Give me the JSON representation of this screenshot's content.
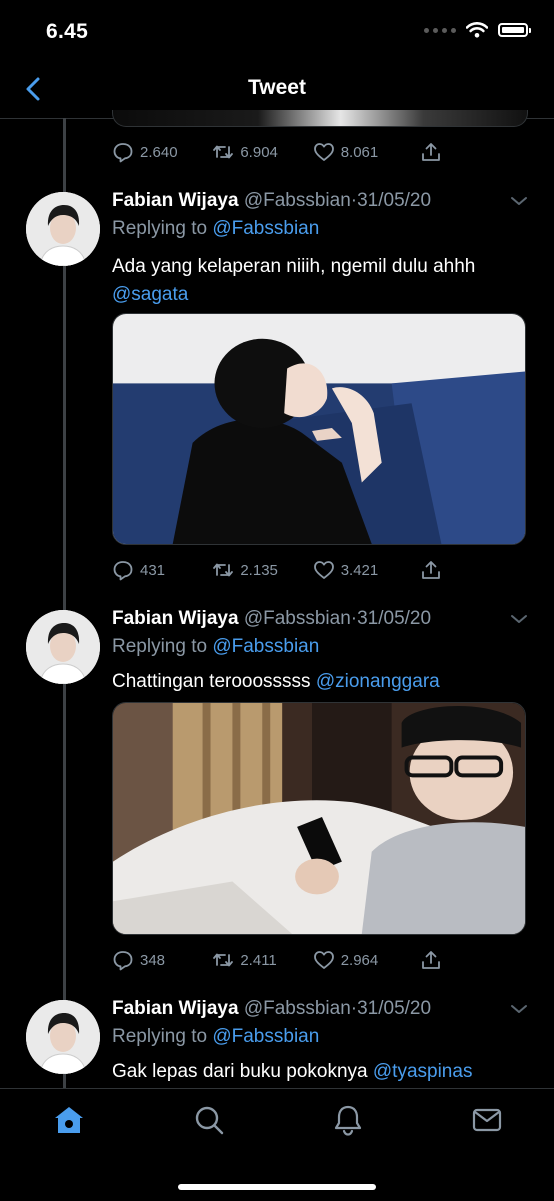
{
  "status_bar": {
    "time": "6.45"
  },
  "nav": {
    "title": "Tweet"
  },
  "previous_tweet": {
    "replies": "2.640",
    "retweets": "6.904",
    "likes": "8.061"
  },
  "tweets": [
    {
      "name": "Fabian Wijaya",
      "handle": "@Fabssbian",
      "separator": "·",
      "date": "31/05/20",
      "replying_prefix": "Replying to",
      "replying_to": "@Fabssbian",
      "text": "Ada yang kelaperan niiih, ngemil dulu ahhh",
      "mention": "@sagata",
      "replies": "431",
      "retweets": "2.135",
      "likes": "3.421"
    },
    {
      "name": "Fabian Wijaya",
      "handle": "@Fabssbian",
      "separator": "·",
      "date": "31/05/20",
      "replying_prefix": "Replying to",
      "replying_to": "@Fabssbian",
      "text": "Chattingan terooosssss",
      "mention": "@zionanggara",
      "replies": "348",
      "retweets": "2.411",
      "likes": "2.964"
    },
    {
      "name": "Fabian Wijaya",
      "handle": "@Fabssbian",
      "separator": "·",
      "date": "31/05/20",
      "replying_prefix": "Replying to",
      "replying_to": "@Fabssbian",
      "text": "Gak lepas dari buku pokoknya",
      "mention": "@tyaspinas"
    }
  ],
  "tab_bar": {
    "items": [
      "home-icon",
      "search-icon",
      "notifications-icon",
      "messages-icon"
    ]
  },
  "colors": {
    "accent": "#4a9ded",
    "muted": "#8b98a5",
    "background": "#000000",
    "divider": "#2f3336"
  }
}
